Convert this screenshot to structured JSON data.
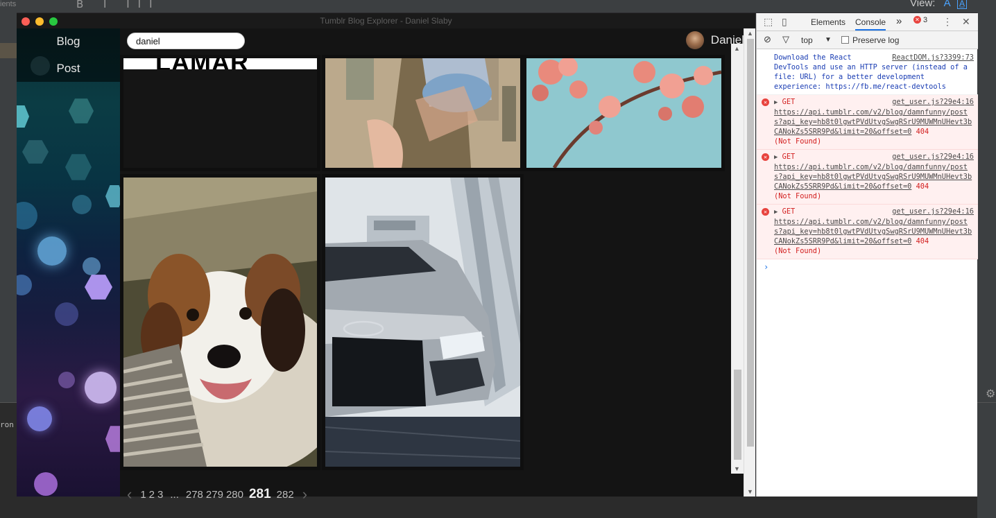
{
  "background": {
    "topleft_text": "ients",
    "toolbar_tools": "B I III",
    "view_label": "View:",
    "view_a": "A",
    "view_b": "A̲",
    "left_panel_text": "ron"
  },
  "window": {
    "title": "Tumblr Blog Explorer - Daniel Slaby"
  },
  "sidebar": {
    "items": [
      {
        "label": "Blog"
      },
      {
        "label": "Post"
      }
    ]
  },
  "header": {
    "search_value": "daniel",
    "username": "Daniel"
  },
  "grid": {
    "lamar_text": "LAMAR"
  },
  "pagination": {
    "prev": "‹",
    "next": "›",
    "pages": [
      "1",
      "2",
      "3",
      "...",
      "278",
      "279",
      "280",
      "281",
      "282"
    ],
    "current": "281"
  },
  "devtools": {
    "tabs": {
      "elements": "Elements",
      "console": "Console",
      "more": "»",
      "error_count": "3",
      "menu": "⋮",
      "close": "✕"
    },
    "toolbar": {
      "context": "top",
      "preserve_log": "Preserve log"
    },
    "messages": {
      "info": {
        "text": "Download the React DevTools and use an HTTP server (instead of a file: URL) for a better development experience: https://fb.me/react-devtools",
        "source": "ReactDOM.js?3399:73"
      },
      "errors": [
        {
          "method": "GET",
          "source": "get_user.js?29e4:16",
          "url": "https://api.tumblr.com/v2/blog/damnfunny/posts?api_key=hb8t0lgwtPVdUtvgSwgRSrU9MUWMnUHevt3bCANokZs5SRR9Pd&limit=20&offset=0",
          "code": "404",
          "status": "(Not Found)"
        },
        {
          "method": "GET",
          "source": "get_user.js?29e4:16",
          "url": "https://api.tumblr.com/v2/blog/damnfunny/posts?api_key=hb8t0lgwtPVdUtvgSwgRSrU9MUWMnUHevt3bCANokZs5SRR9Pd&limit=20&offset=0",
          "code": "404",
          "status": "(Not Found)"
        },
        {
          "method": "GET",
          "source": "get_user.js?29e4:16",
          "url": "https://api.tumblr.com/v2/blog/damnfunny/posts?api_key=hb8t0lgwtPVdUtvgSwgRSrU9MUWMnUHevt3bCANokZs5SRR9Pd&limit=20&offset=0",
          "code": "404",
          "status": "(Not Found)"
        }
      ]
    },
    "prompt": "›"
  }
}
